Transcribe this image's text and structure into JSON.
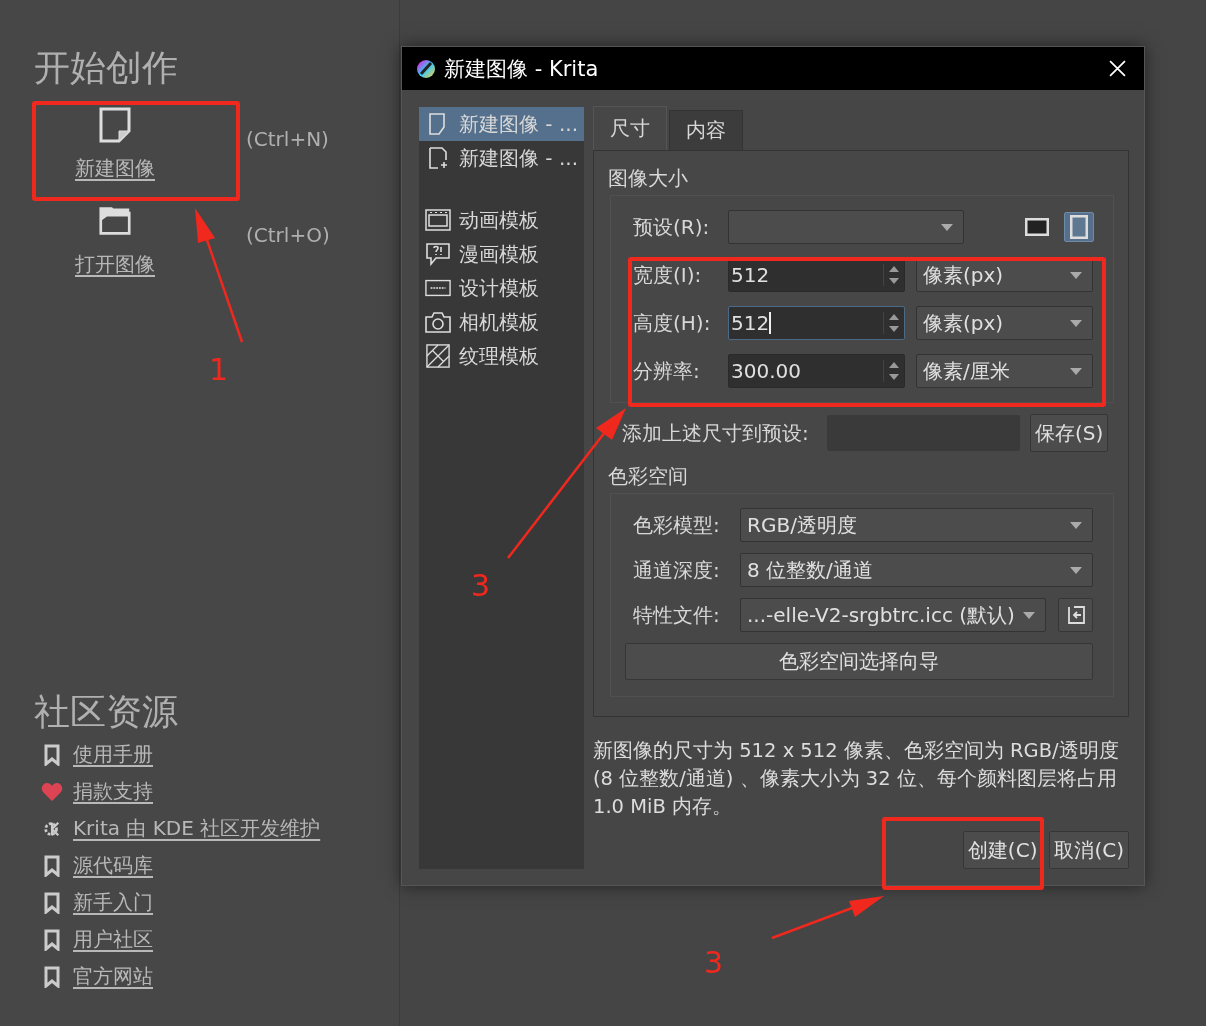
{
  "start": {
    "title": "开始创作",
    "actions": [
      {
        "kind": "new",
        "label": "新建图像",
        "shortcut": "(Ctrl+N)"
      },
      {
        "kind": "open",
        "label": "打开图像",
        "shortcut": "(Ctrl+O)"
      }
    ]
  },
  "community": {
    "title": "社区资源",
    "links": [
      {
        "kind": "bookmark",
        "label": "使用手册"
      },
      {
        "kind": "heart",
        "label": "捐款支持"
      },
      {
        "kind": "kde",
        "label": "Krita 由 KDE 社区开发维护"
      },
      {
        "kind": "bookmark",
        "label": "源代码库"
      },
      {
        "kind": "bookmark",
        "label": "新手入门"
      },
      {
        "kind": "bookmark",
        "label": "用户社区"
      },
      {
        "kind": "bookmark",
        "label": "官方网站"
      }
    ]
  },
  "dialog": {
    "title": "新建图像 - Krita",
    "documents": [
      {
        "kind": "doc",
        "label": "新建图像 - ...",
        "selected": true
      },
      {
        "kind": "doc-add",
        "label": "新建图像 - ...",
        "selected": false
      }
    ],
    "templates": [
      {
        "kind": "animation",
        "label": "动画模板",
        "selected": false
      },
      {
        "kind": "comic",
        "label": "漫画模板",
        "selected": false
      },
      {
        "kind": "design",
        "label": "设计模板",
        "selected": false
      },
      {
        "kind": "camera",
        "label": "相机模板",
        "selected": false
      },
      {
        "kind": "texture",
        "label": "纹理模板",
        "selected": false
      }
    ],
    "tabs": [
      {
        "label": "尺寸",
        "selected": true
      },
      {
        "label": "内容",
        "selected": false
      }
    ],
    "image_size": {
      "heading": "图像大小",
      "preset_label": "预设(R):",
      "orientations": [
        {
          "kind": "landscape",
          "selected": false
        },
        {
          "kind": "portrait",
          "selected": true
        }
      ],
      "fields": [
        {
          "label": "宽度(I):",
          "value": "512",
          "unit": "像素(px)",
          "focused": false
        },
        {
          "label": "高度(H):",
          "value": "512",
          "unit": "像素(px)",
          "focused": true
        },
        {
          "label": "分辨率:",
          "value": "300.00",
          "unit": "像素/厘米",
          "focused": false
        }
      ]
    },
    "save_preset": {
      "label": "添加上述尺寸到预设:",
      "button": "保存(S)"
    },
    "color_space": {
      "heading": "色彩空间",
      "rows": [
        {
          "kind": "combo",
          "label": "色彩模型:",
          "value": "RGB/透明度"
        },
        {
          "kind": "combo",
          "label": "通道深度:",
          "value": "8 位整数/通道"
        },
        {
          "kind": "profile",
          "label": "特性文件:",
          "value": "...-elle-V2-srgbtrc.icc (默认)"
        }
      ],
      "wizard": "色彩空间选择向导"
    },
    "summary": "新图像的尺寸为 512 x 512 像素、色彩空间为 RGB/透明度 (8 位整数/通道) 、像素大小为 32 位、每个颜料图层将占用 1.0 MiB 内存。",
    "buttons": [
      "创建(C)",
      "取消(C)"
    ]
  },
  "annotations": [
    {
      "number": "1"
    },
    {
      "number": "3"
    },
    {
      "number": "3"
    }
  ]
}
